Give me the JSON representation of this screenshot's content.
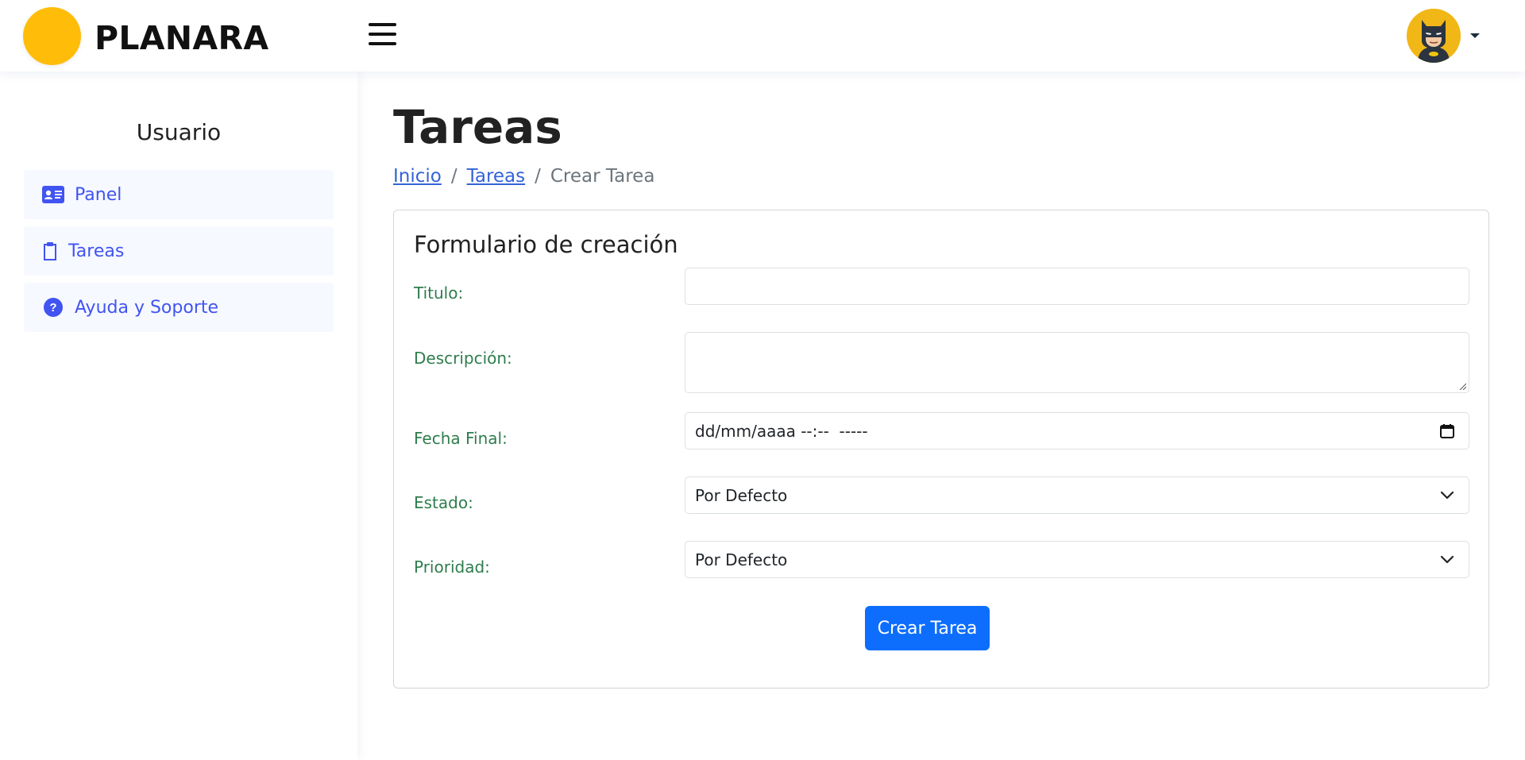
{
  "brand": {
    "name": "PLANARA",
    "logo_color": "#ffbd0a"
  },
  "header": {
    "menu_icon": "hamburger-icon",
    "avatar_icon": "batman-avatar",
    "caret_icon": "caret-down-icon"
  },
  "sidebar": {
    "title": "Usuario",
    "items": [
      {
        "label": "Panel",
        "icon": "id-card-icon"
      },
      {
        "label": "Tareas",
        "icon": "clipboard-icon"
      },
      {
        "label": "Ayuda y Soporte",
        "icon": "question-circle-icon"
      }
    ]
  },
  "main": {
    "title": "Tareas",
    "breadcrumb": {
      "home": "Inicio",
      "section": "Tareas",
      "current": "Crear Tarea",
      "separator": "/"
    },
    "form": {
      "title": "Formulario de creación",
      "fields": {
        "titulo": {
          "label": "Titulo:",
          "value": ""
        },
        "descripcion": {
          "label": "Descripción:",
          "value": ""
        },
        "fecha_final": {
          "label": "Fecha Final:",
          "value": "dd/mm/aaaa --:--  -----"
        },
        "estado": {
          "label": "Estado:",
          "value": "Por Defecto"
        },
        "prioridad": {
          "label": "Prioridad:",
          "value": "Por Defecto"
        }
      },
      "submit_label": "Crear Tarea"
    }
  },
  "colors": {
    "accent": "#4154f1",
    "primary_button": "#0d6efd",
    "label_green": "#2f7d4d",
    "link": "#3463d8"
  }
}
